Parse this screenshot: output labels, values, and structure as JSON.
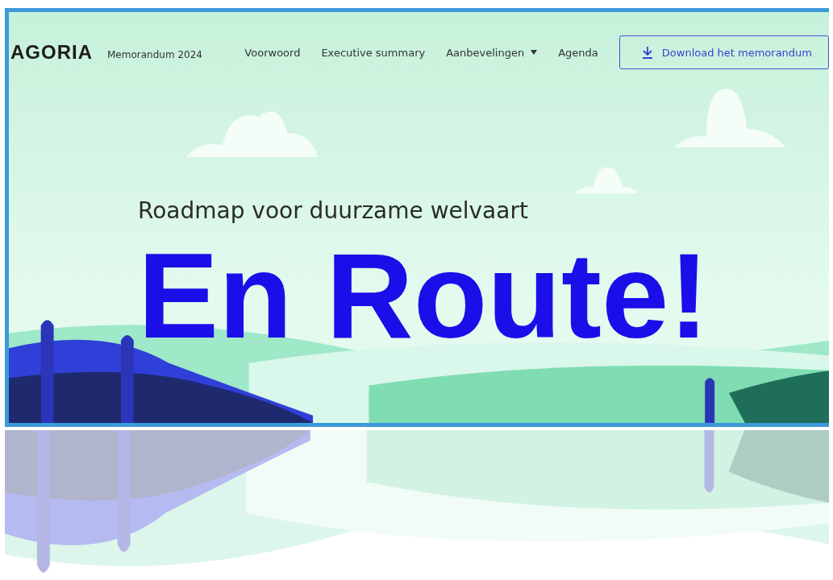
{
  "header": {
    "logo": "AGORIA",
    "tagline": "Memorandum 2024",
    "nav": [
      {
        "label": "Voorwoord",
        "kind": "link"
      },
      {
        "label": "Executive summary",
        "kind": "link"
      },
      {
        "label": "Aanbevelingen",
        "kind": "dropdown"
      },
      {
        "label": "Agenda",
        "kind": "link"
      }
    ],
    "download_button": "Download het memorandum"
  },
  "hero": {
    "subtitle": "Roadmap voor duurzame welvaart",
    "headline": "En Route!"
  }
}
